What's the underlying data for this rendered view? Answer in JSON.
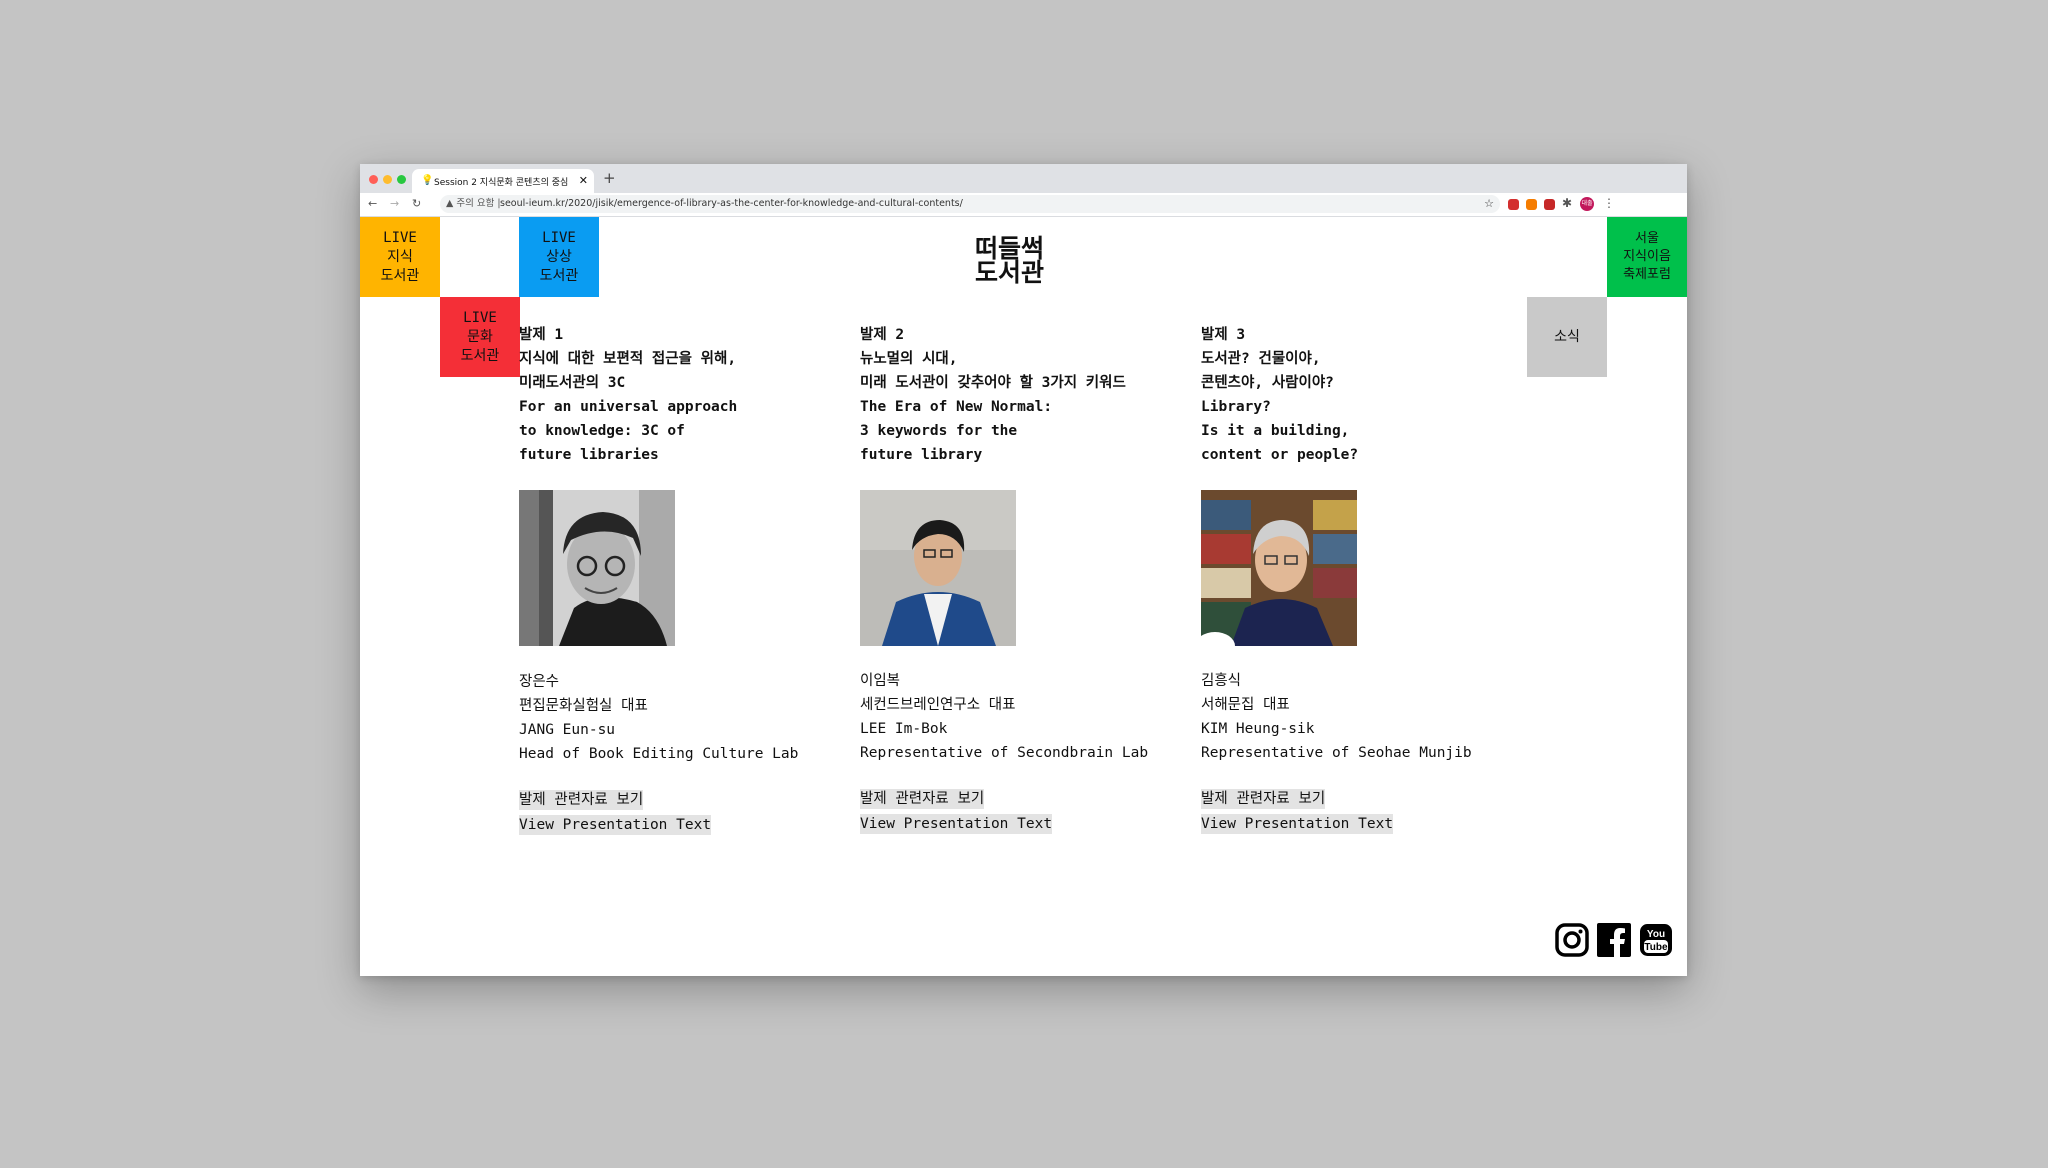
{
  "browser": {
    "tab_title": "Session 2 지식문화 콘텐츠의 중심",
    "new_tab_label": "+",
    "security_label": "주의 요함",
    "url": "seoul-ieum.kr/2020/jisik/emergence-of-library-as-the-center-for-knowledge-and-cultural-contents/",
    "profile_label": "대출"
  },
  "nav": {
    "live_knowledge": [
      "LIVE",
      "지식",
      "도서관"
    ],
    "live_imagination": [
      "LIVE",
      "상상",
      "도서관"
    ],
    "live_culture": [
      "LIVE",
      "문화",
      "도서관"
    ],
    "forum": [
      "서울",
      "지식이음",
      "축제포럼"
    ],
    "news": "소식"
  },
  "logo": {
    "line1": "떠들썩",
    "line2": "도서관"
  },
  "sessions": [
    {
      "title_lines": [
        "발제 1",
        "지식에 대한 보편적 접근을 위해,",
        "미래도서관의 3C",
        "For an universal approach",
        "to knowledge: 3C of",
        "future libraries"
      ],
      "name_ko": "장은수",
      "role_ko": "편집문화실험실 대표",
      "name_en": "JANG Eun-su",
      "role_en": "Head of Book Editing Culture Lab",
      "link_ko": "발제 관련자료 보기",
      "link_en": "View Presentation Text"
    },
    {
      "title_lines": [
        "발제 2",
        "뉴노멀의 시대,",
        "미래 도서관이 갖추어야 할 3가지 키워드",
        "The Era of New Normal:",
        "3 keywords for the",
        "future library"
      ],
      "name_ko": "이임복",
      "role_ko": "세컨드브레인연구소 대표",
      "name_en": "LEE Im-Bok",
      "role_en": "Representative of Secondbrain Lab",
      "link_ko": "발제 관련자료 보기",
      "link_en": "View Presentation Text"
    },
    {
      "title_lines": [
        "발제 3",
        "도서관? 건물이야,",
        "콘텐츠야, 사람이야?",
        "Library?",
        "Is it a building,",
        "content or people?"
      ],
      "name_ko": "김흥식",
      "role_ko": "서해문집 대표",
      "name_en": "KIM Heung-sik",
      "role_en": "Representative of Seohae Munjib",
      "link_ko": "발제 관련자료 보기",
      "link_en": "View Presentation Text"
    }
  ],
  "social": {
    "youtube_line1": "You",
    "youtube_line2": "Tube"
  },
  "colors": {
    "knowledge": "#ffb400",
    "imagination": "#0a9cf2",
    "culture": "#f42f37",
    "forum": "#00c04b",
    "news": "#c9c9c9"
  }
}
